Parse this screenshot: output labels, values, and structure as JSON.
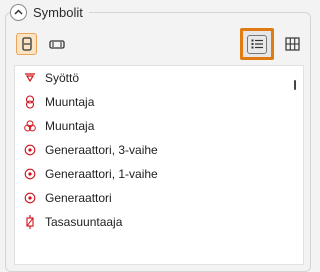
{
  "panel": {
    "title": "Symbolit",
    "icons": {
      "collapse": "chevron-up-icon",
      "vertical": "vertical-layout-icon",
      "horizontal": "horizontal-layout-icon",
      "list": "list-view-icon",
      "grid": "grid-view-icon"
    }
  },
  "symbols": [
    {
      "label": "Syöttö",
      "icon": "feed-triangle-icon"
    },
    {
      "label": "Muuntaja",
      "icon": "transformer-icon"
    },
    {
      "label": "Muuntaja",
      "icon": "transformer-three-winding-icon"
    },
    {
      "label": "Generaattori, 3-vaihe",
      "icon": "generator-icon"
    },
    {
      "label": "Generaattori, 1-vaihe",
      "icon": "generator-icon"
    },
    {
      "label": "Generaattori",
      "icon": "generator-icon"
    },
    {
      "label": "Tasasuuntaaja",
      "icon": "rectifier-icon"
    }
  ],
  "colors": {
    "accent": "#e07a12",
    "symbol_red": "#d0101a",
    "selected_bg": "#fbe3c4"
  }
}
